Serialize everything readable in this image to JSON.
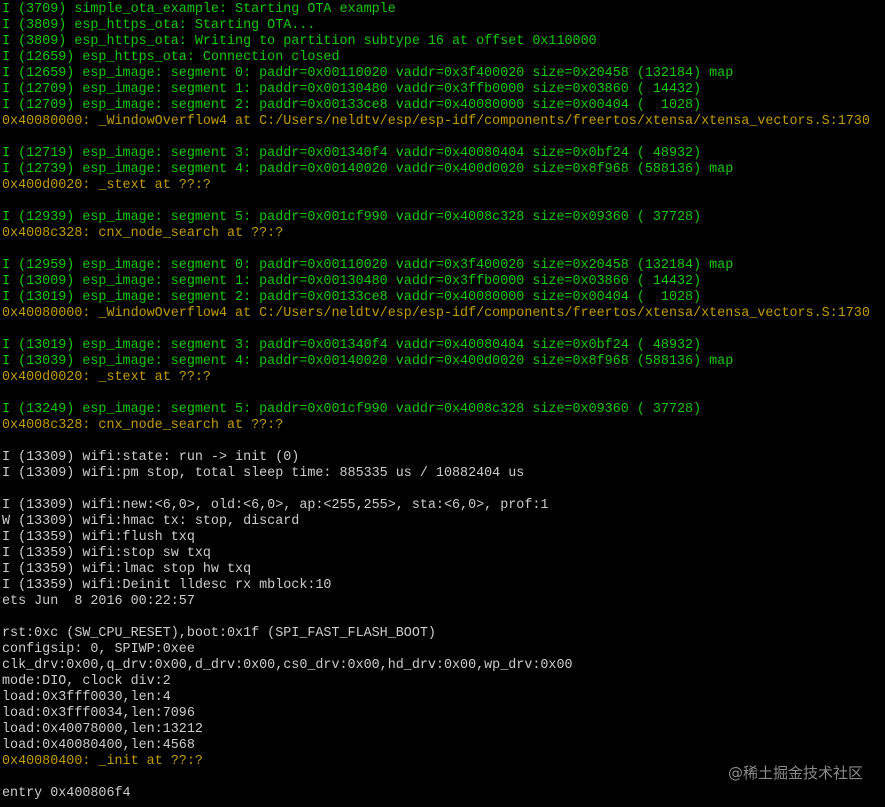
{
  "colors": {
    "background": "#000000",
    "green": "#16c60c",
    "yellow": "#c19c00",
    "white": "#cccccc",
    "watermark": "#8a8a8a"
  },
  "lines": [
    {
      "c": "green",
      "t": "I (3709) simple_ota_example: Starting OTA example"
    },
    {
      "c": "green",
      "t": "I (3809) esp_https_ota: Starting OTA..."
    },
    {
      "c": "green",
      "t": "I (3809) esp_https_ota: Writing to partition subtype 16 at offset 0x110000"
    },
    {
      "c": "green",
      "t": "I (12659) esp_https_ota: Connection closed"
    },
    {
      "c": "green",
      "t": "I (12659) esp_image: segment 0: paddr=0x00110020 vaddr=0x3f400020 size=0x20458 (132184) map"
    },
    {
      "c": "green",
      "t": "I (12709) esp_image: segment 1: paddr=0x00130480 vaddr=0x3ffb0000 size=0x03860 ( 14432)"
    },
    {
      "c": "green",
      "t": "I (12709) esp_image: segment 2: paddr=0x00133ce8 vaddr=0x40080000 size=0x00404 (  1028)"
    },
    {
      "c": "yellow",
      "t": "0x40080000: _WindowOverflow4 at C:/Users/neldtv/esp/esp-idf/components/freertos/xtensa/xtensa_vectors.S:1730"
    },
    {
      "c": "white",
      "t": ""
    },
    {
      "c": "green",
      "t": "I (12719) esp_image: segment 3: paddr=0x001340f4 vaddr=0x40080404 size=0x0bf24 ( 48932)"
    },
    {
      "c": "green",
      "t": "I (12739) esp_image: segment 4: paddr=0x00140020 vaddr=0x400d0020 size=0x8f968 (588136) map"
    },
    {
      "c": "yellow",
      "t": "0x400d0020: _stext at ??:?"
    },
    {
      "c": "white",
      "t": ""
    },
    {
      "c": "green",
      "t": "I (12939) esp_image: segment 5: paddr=0x001cf990 vaddr=0x4008c328 size=0x09360 ( 37728)"
    },
    {
      "c": "yellow",
      "t": "0x4008c328: cnx_node_search at ??:?"
    },
    {
      "c": "white",
      "t": ""
    },
    {
      "c": "green",
      "t": "I (12959) esp_image: segment 0: paddr=0x00110020 vaddr=0x3f400020 size=0x20458 (132184) map"
    },
    {
      "c": "green",
      "t": "I (13009) esp_image: segment 1: paddr=0x00130480 vaddr=0x3ffb0000 size=0x03860 ( 14432)"
    },
    {
      "c": "green",
      "t": "I (13019) esp_image: segment 2: paddr=0x00133ce8 vaddr=0x40080000 size=0x00404 (  1028)"
    },
    {
      "c": "yellow",
      "t": "0x40080000: _WindowOverflow4 at C:/Users/neldtv/esp/esp-idf/components/freertos/xtensa/xtensa_vectors.S:1730"
    },
    {
      "c": "white",
      "t": ""
    },
    {
      "c": "green",
      "t": "I (13019) esp_image: segment 3: paddr=0x001340f4 vaddr=0x40080404 size=0x0bf24 ( 48932)"
    },
    {
      "c": "green",
      "t": "I (13039) esp_image: segment 4: paddr=0x00140020 vaddr=0x400d0020 size=0x8f968 (588136) map"
    },
    {
      "c": "yellow",
      "t": "0x400d0020: _stext at ??:?"
    },
    {
      "c": "white",
      "t": ""
    },
    {
      "c": "green",
      "t": "I (13249) esp_image: segment 5: paddr=0x001cf990 vaddr=0x4008c328 size=0x09360 ( 37728)"
    },
    {
      "c": "yellow",
      "t": "0x4008c328: cnx_node_search at ??:?"
    },
    {
      "c": "white",
      "t": ""
    },
    {
      "c": "white",
      "t": "I (13309) wifi:state: run -> init (0)"
    },
    {
      "c": "white",
      "t": "I (13309) wifi:pm stop, total sleep time: 885335 us / 10882404 us"
    },
    {
      "c": "white",
      "t": ""
    },
    {
      "c": "white",
      "t": "I (13309) wifi:new:<6,0>, old:<6,0>, ap:<255,255>, sta:<6,0>, prof:1"
    },
    {
      "c": "white",
      "t": "W (13309) wifi:hmac tx: stop, discard"
    },
    {
      "c": "white",
      "t": "I (13359) wifi:flush txq"
    },
    {
      "c": "white",
      "t": "I (13359) wifi:stop sw txq"
    },
    {
      "c": "white",
      "t": "I (13359) wifi:lmac stop hw txq"
    },
    {
      "c": "white",
      "t": "I (13359) wifi:Deinit lldesc rx mblock:10"
    },
    {
      "c": "white",
      "t": "ets Jun  8 2016 00:22:57"
    },
    {
      "c": "white",
      "t": ""
    },
    {
      "c": "white",
      "t": "rst:0xc (SW_CPU_RESET),boot:0x1f (SPI_FAST_FLASH_BOOT)"
    },
    {
      "c": "white",
      "t": "configsip: 0, SPIWP:0xee"
    },
    {
      "c": "white",
      "t": "clk_drv:0x00,q_drv:0x00,d_drv:0x00,cs0_drv:0x00,hd_drv:0x00,wp_drv:0x00"
    },
    {
      "c": "white",
      "t": "mode:DIO, clock div:2"
    },
    {
      "c": "white",
      "t": "load:0x3fff0030,len:4"
    },
    {
      "c": "white",
      "t": "load:0x3fff0034,len:7096"
    },
    {
      "c": "white",
      "t": "load:0x40078000,len:13212"
    },
    {
      "c": "white",
      "t": "load:0x40080400,len:4568"
    },
    {
      "c": "yellow",
      "t": "0x40080400: _init at ??:?"
    },
    {
      "c": "white",
      "t": ""
    },
    {
      "c": "white",
      "t": "entry 0x400806f4"
    }
  ],
  "watermark": "@稀土掘金技术社区"
}
